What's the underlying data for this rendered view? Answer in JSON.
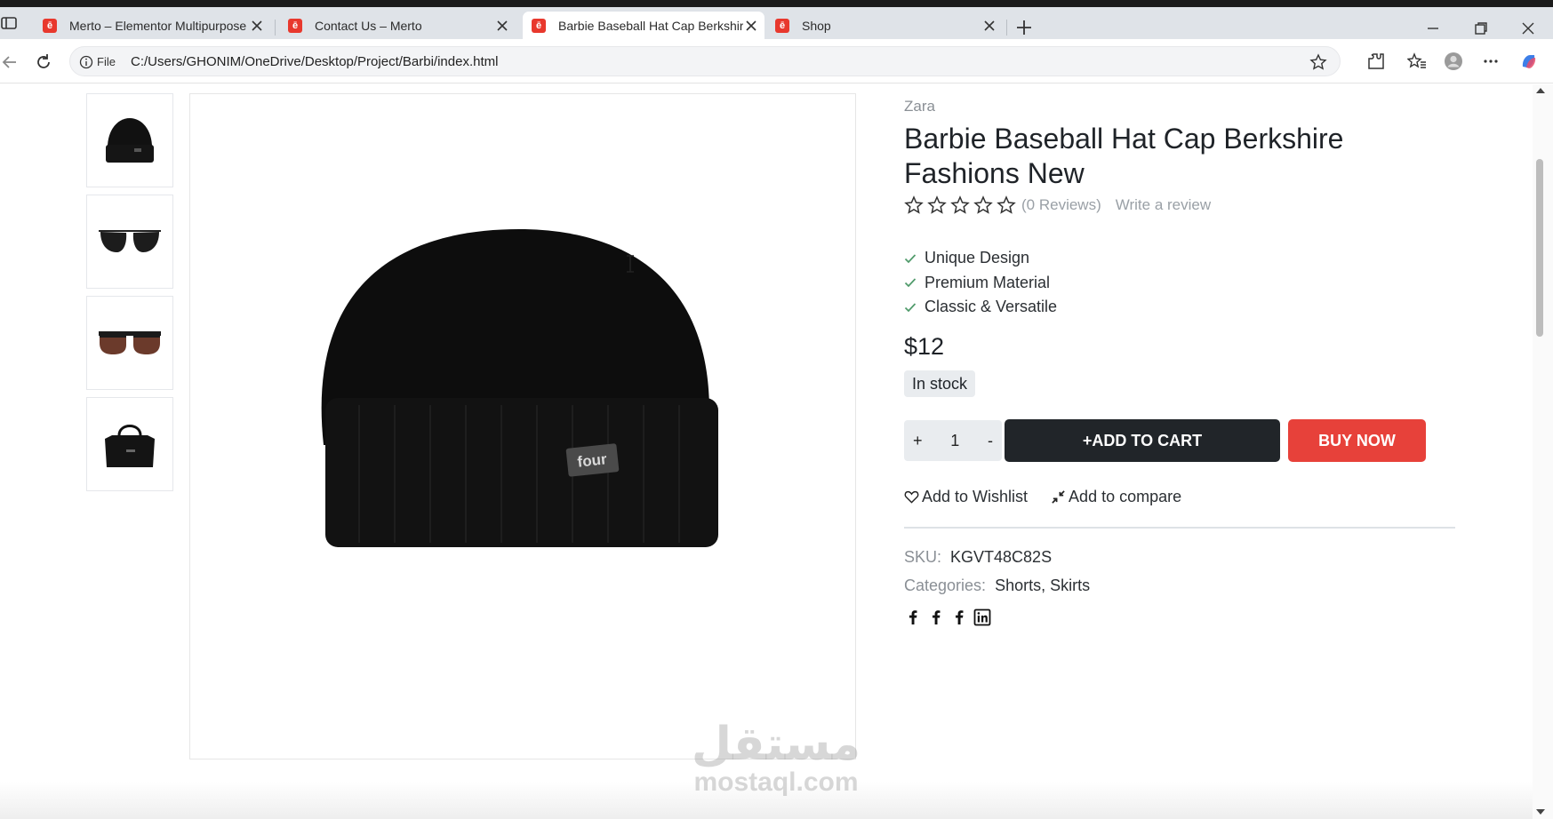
{
  "browser": {
    "tabs": [
      {
        "title": "Merto – Elementor Multipurpose",
        "favicon": "ē",
        "active": false
      },
      {
        "title": "Contact Us – Merto",
        "favicon": "ē",
        "active": false
      },
      {
        "title": "Barbie Baseball Hat Cap Berkshire",
        "favicon": "ē",
        "active": true
      },
      {
        "title": "Shop",
        "favicon": "ē",
        "active": false
      }
    ],
    "file_label": "File",
    "url": "C:/Users/GHONIM/OneDrive/Desktop/Project/Barbi/index.html",
    "icons": [
      "sidebar-toggle-icon",
      "close-icon",
      "plus-icon",
      "minimize-icon",
      "restore-icon",
      "back-arrow-icon",
      "reload-icon",
      "info-icon",
      "star-icon",
      "extensions-icon",
      "favorites-icon",
      "profile-icon",
      "more-icon",
      "copilot-icon"
    ]
  },
  "gallery": {
    "thumbnails": [
      "black-beanie",
      "aviator-sunglasses",
      "brown-sunglasses",
      "black-handbag"
    ],
    "main_image": "black-beanie",
    "main_image_label": "four"
  },
  "product": {
    "brand": "Zara",
    "title": "Barbie Baseball Hat Cap Berkshire Fashions New",
    "rating": 0,
    "reviews_text": "(0 Reviews)",
    "write_review": "Write a review",
    "features": [
      "Unique Design",
      "Premium Material",
      "Classic & Versatile"
    ],
    "price": "$12",
    "stock": "In stock",
    "qty_plus": "+",
    "qty_value": "1",
    "qty_minus": "-",
    "add_to_cart": "+ADD TO CART",
    "buy_now": "BUY NOW",
    "wishlist": "Add to Wishlist",
    "compare": "Add to compare",
    "sku_label": "SKU:",
    "sku": "KGVT48C82S",
    "categories_label": "Categories:",
    "categories": "Shorts, Skirts",
    "social": [
      "facebook-icon",
      "facebook-icon",
      "facebook-icon",
      "linkedin-icon"
    ]
  },
  "watermark": {
    "arabic": "مستقل",
    "latin": "mostaql.com"
  },
  "colors": {
    "accent_red": "#e7413a",
    "cart_dark": "#212529",
    "favicon_red": "#e8382d",
    "check_green": "#4f9a6a"
  }
}
